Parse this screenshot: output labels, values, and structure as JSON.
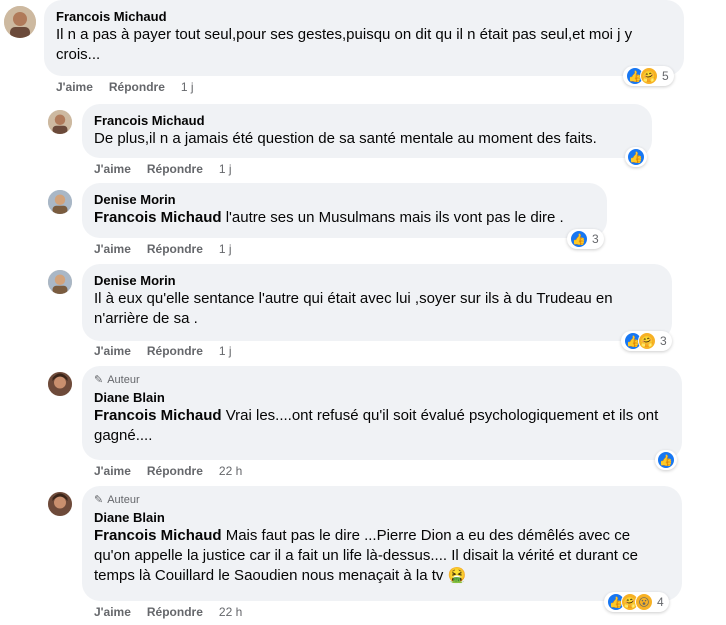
{
  "colors": {
    "like": "#1877f2",
    "bubble": "#f0f2f5",
    "meta": "#65676b"
  },
  "comments": [
    {
      "name": "Francois Michaud",
      "text": "Il n a pas à payer tout seul,pour ses gestes,puisqu on dit qu il n était pas seul,et moi j y crois...",
      "like": "J'aime",
      "reply": "Répondre",
      "time": "1 j",
      "reactions_count": "5"
    },
    {
      "name": "Francois Michaud",
      "text": "De plus,il n a jamais été question de sa santé mentale au moment des faits.",
      "like": "J'aime",
      "reply": "Répondre",
      "time": "1 j"
    },
    {
      "name": "Denise Morin",
      "mention": "Francois Michaud",
      "text": " l'autre ses un Musulmans mais ils vont pas le dire .",
      "like": "J'aime",
      "reply": "Répondre",
      "time": "1 j",
      "reactions_count": "3"
    },
    {
      "name": "Denise Morin",
      "text": "Il à eux qu'elle sentance l'autre qui était avec lui ,soyer sur ils à du Trudeau en n'arrière de sa .",
      "like": "J'aime",
      "reply": "Répondre",
      "time": "1 j",
      "reactions_count": "3"
    },
    {
      "badge": "Auteur",
      "name": "Diane Blain",
      "mention": "Francois Michaud",
      "text": " Vrai les....ont refusé qu'il soit évalué psychologiquement et ils ont gagné....",
      "like": "J'aime",
      "reply": "Répondre",
      "time": "22 h"
    },
    {
      "badge": "Auteur",
      "name": "Diane Blain",
      "mention": "Francois Michaud",
      "text": " Mais faut pas le dire ...Pierre Dion a eu des démêlés avec ce qu'on appelle la justice car il a fait un life là-dessus.... Il disait la vérité et durant ce temps là Couillard le Saoudien nous menaçait à la tv 🤮",
      "like": "J'aime",
      "reply": "Répondre",
      "time": "22 h",
      "reactions_count": "4"
    }
  ]
}
